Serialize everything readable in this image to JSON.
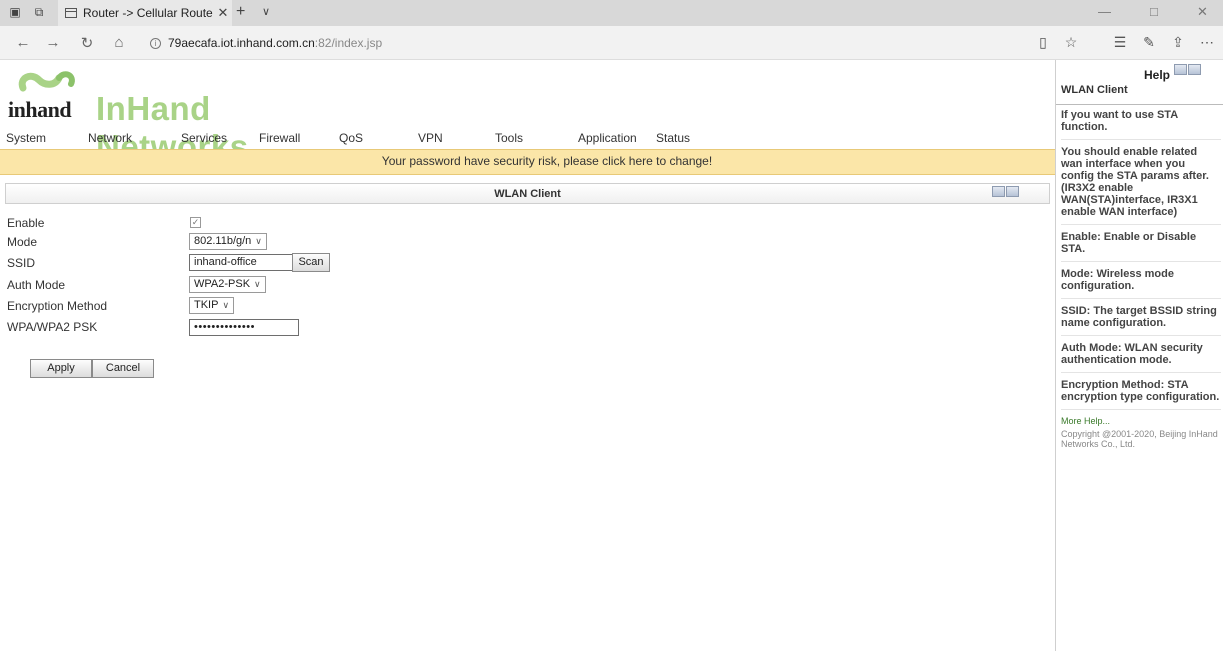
{
  "browser": {
    "tab_title": "Router -> Cellular Route",
    "url_host": "79aecafa.iot.inhand.com.cn",
    "url_path": ":82/index.jsp"
  },
  "app": {
    "brand_name": "InHand Networks",
    "logo_word": "inhand",
    "menu": [
      "System",
      "Network",
      "Services",
      "Firewall",
      "QoS",
      "VPN",
      "Tools",
      "Application",
      "Status"
    ],
    "warning": "Your password have security risk, please click here to change!"
  },
  "panel": {
    "title": "WLAN Client",
    "fields": {
      "enable": {
        "label": "Enable",
        "checked": true
      },
      "mode": {
        "label": "Mode",
        "value": "802.11b/g/n"
      },
      "ssid": {
        "label": "SSID",
        "value": "inhand-office",
        "button": "Scan"
      },
      "auth_mode": {
        "label": "Auth Mode",
        "value": "WPA2-PSK"
      },
      "encryption": {
        "label": "Encryption Method",
        "value": "TKIP"
      },
      "psk": {
        "label": "WPA/WPA2 PSK",
        "value": "••••••••••••••"
      }
    },
    "apply_label": "Apply",
    "cancel_label": "Cancel"
  },
  "help": {
    "title": "Help",
    "subtitle": "WLAN Client",
    "paragraphs": [
      "If you want to use STA function.",
      "You should enable related wan interface when you config the STA params after.(IR3X2 enable WAN(STA)interface, IR3X1 enable WAN interface)",
      "Enable: Enable or Disable STA.",
      "Mode: Wireless mode configuration.",
      "SSID: The target BSSID string name configuration.",
      "Auth Mode: WLAN security authentication mode.",
      "Encryption Method: STA encryption type configuration."
    ],
    "more_help": "More Help...",
    "copyright": "Copyright @2001-2020, Beijing InHand Networks Co., Ltd."
  },
  "colors": {
    "brand_green": "#a9d387",
    "warning_bg": "#fbe6a8",
    "help_link": "#3a7a2a"
  }
}
